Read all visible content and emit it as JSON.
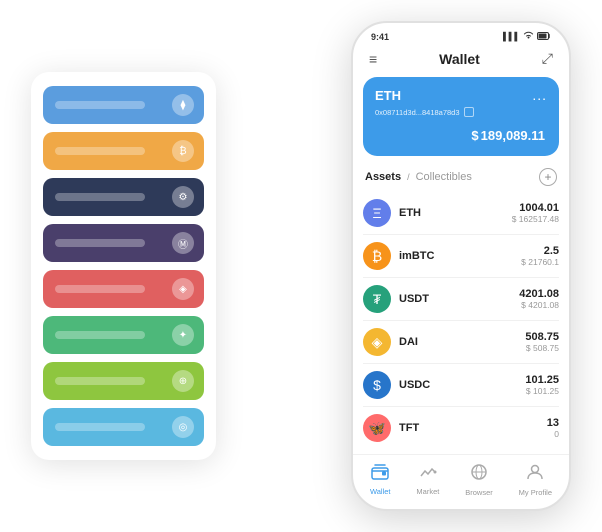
{
  "app": {
    "title": "Wallet"
  },
  "statusBar": {
    "time": "9:41",
    "signal": "▌▌▌",
    "wifi": "wifi",
    "battery": "battery"
  },
  "navBar": {
    "menuIcon": "≡",
    "title": "Wallet",
    "expandIcon": "⤢"
  },
  "ethCard": {
    "name": "ETH",
    "address": "0x08711d3d...8418a78d3",
    "copyIcon": "copy",
    "dotsMenu": "...",
    "balancePrefix": "$",
    "balance": "189,089.11"
  },
  "assetsSection": {
    "activeTab": "Assets",
    "separator": "/",
    "inactiveTab": "Collectibles",
    "addIcon": "+"
  },
  "assets": [
    {
      "symbol": "ETH",
      "iconType": "eth",
      "iconChar": "Ξ",
      "amount": "1004.01",
      "usdValue": "$ 162517.48"
    },
    {
      "symbol": "imBTC",
      "iconType": "imbtc",
      "iconChar": "₿",
      "amount": "2.5",
      "usdValue": "$ 21760.1"
    },
    {
      "symbol": "USDT",
      "iconType": "usdt",
      "iconChar": "₮",
      "amount": "4201.08",
      "usdValue": "$ 4201.08"
    },
    {
      "symbol": "DAI",
      "iconType": "dai",
      "iconChar": "◈",
      "amount": "508.75",
      "usdValue": "$ 508.75"
    },
    {
      "symbol": "USDC",
      "iconType": "usdc",
      "iconChar": "$",
      "amount": "101.25",
      "usdValue": "$ 101.25"
    },
    {
      "symbol": "TFT",
      "iconType": "tft",
      "iconChar": "🦋",
      "amount": "13",
      "usdValue": "0"
    }
  ],
  "bottomNav": [
    {
      "icon": "💼",
      "label": "Wallet",
      "active": true
    },
    {
      "icon": "📈",
      "label": "Market",
      "active": false
    },
    {
      "icon": "🌐",
      "label": "Browser",
      "active": false
    },
    {
      "icon": "👤",
      "label": "My Profile",
      "active": false
    }
  ],
  "cardStack": [
    {
      "color": "card-blue"
    },
    {
      "color": "card-orange"
    },
    {
      "color": "card-dark"
    },
    {
      "color": "card-purple"
    },
    {
      "color": "card-red"
    },
    {
      "color": "card-green"
    },
    {
      "color": "card-lime"
    },
    {
      "color": "card-sky"
    }
  ]
}
